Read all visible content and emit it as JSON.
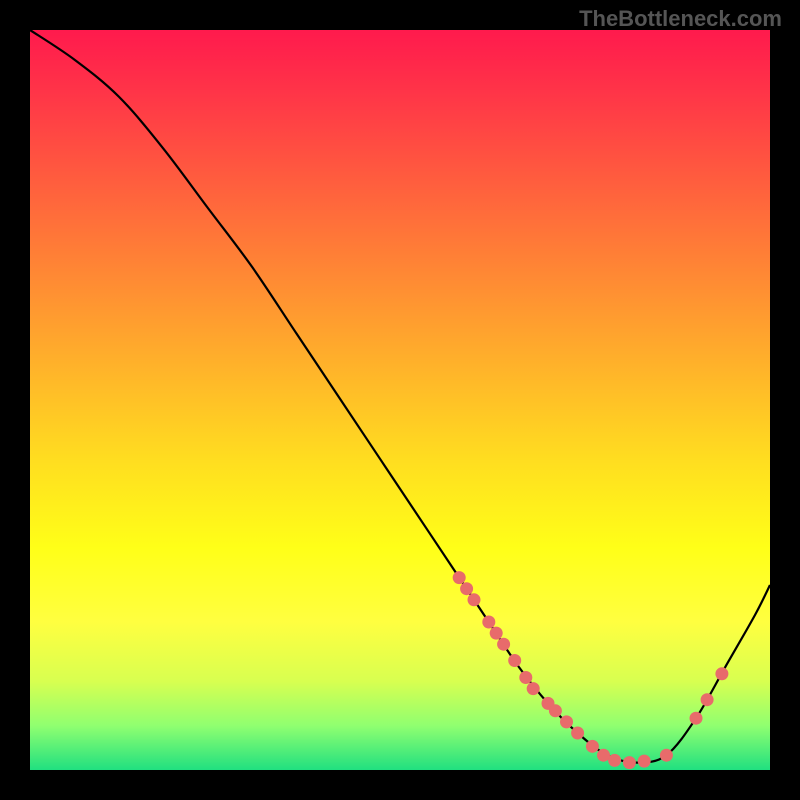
{
  "watermark": "TheBottleneck.com",
  "chart_data": {
    "type": "line",
    "title": "",
    "xlabel": "",
    "ylabel": "",
    "xlim": [
      0,
      100
    ],
    "ylim": [
      0,
      100
    ],
    "curve": {
      "name": "bottleneck-curve",
      "x": [
        0,
        6,
        12,
        18,
        24,
        30,
        36,
        42,
        48,
        54,
        58,
        62,
        66,
        70,
        74,
        78,
        82,
        86,
        90,
        94,
        98,
        100
      ],
      "y": [
        100,
        96,
        91,
        84,
        76,
        68,
        59,
        50,
        41,
        32,
        26,
        20,
        14,
        9,
        5,
        2,
        1,
        2,
        7,
        14,
        21,
        25
      ]
    },
    "markers": {
      "name": "highlight-dots",
      "color": "#e86b6b",
      "points": [
        {
          "x": 58,
          "y": 26
        },
        {
          "x": 59,
          "y": 24.5
        },
        {
          "x": 60,
          "y": 23
        },
        {
          "x": 62,
          "y": 20
        },
        {
          "x": 63,
          "y": 18.5
        },
        {
          "x": 64,
          "y": 17
        },
        {
          "x": 65.5,
          "y": 14.8
        },
        {
          "x": 67,
          "y": 12.5
        },
        {
          "x": 68,
          "y": 11
        },
        {
          "x": 70,
          "y": 9
        },
        {
          "x": 71,
          "y": 8
        },
        {
          "x": 72.5,
          "y": 6.5
        },
        {
          "x": 74,
          "y": 5
        },
        {
          "x": 76,
          "y": 3.2
        },
        {
          "x": 77.5,
          "y": 2
        },
        {
          "x": 79,
          "y": 1.3
        },
        {
          "x": 81,
          "y": 1
        },
        {
          "x": 83,
          "y": 1.2
        },
        {
          "x": 86,
          "y": 2
        },
        {
          "x": 90,
          "y": 7
        },
        {
          "x": 91.5,
          "y": 9.5
        },
        {
          "x": 93.5,
          "y": 13
        }
      ]
    },
    "gradient_stops": [
      {
        "pos": 0,
        "color": "#ff1a4d"
      },
      {
        "pos": 18,
        "color": "#ff5540"
      },
      {
        "pos": 38,
        "color": "#ff9930"
      },
      {
        "pos": 58,
        "color": "#ffdd20"
      },
      {
        "pos": 80,
        "color": "#ffff40"
      },
      {
        "pos": 94,
        "color": "#90ff70"
      },
      {
        "pos": 100,
        "color": "#20e080"
      }
    ]
  }
}
